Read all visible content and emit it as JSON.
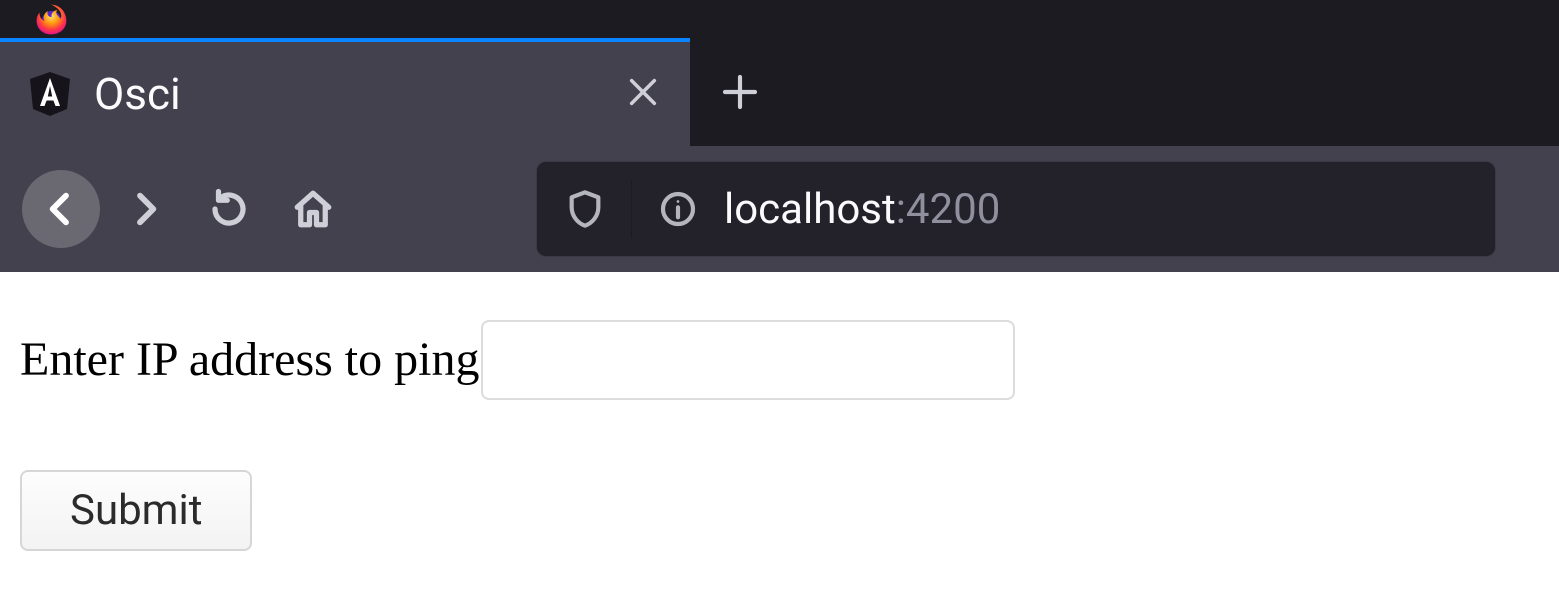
{
  "browser": {
    "tab": {
      "title": "Osci",
      "favicon": "angular-shield-icon"
    },
    "url": {
      "host": "localhost",
      "port_suffix": ":4200"
    }
  },
  "page": {
    "form": {
      "label": "Enter IP address to ping",
      "ip_value": "",
      "submit_label": "Submit"
    }
  }
}
